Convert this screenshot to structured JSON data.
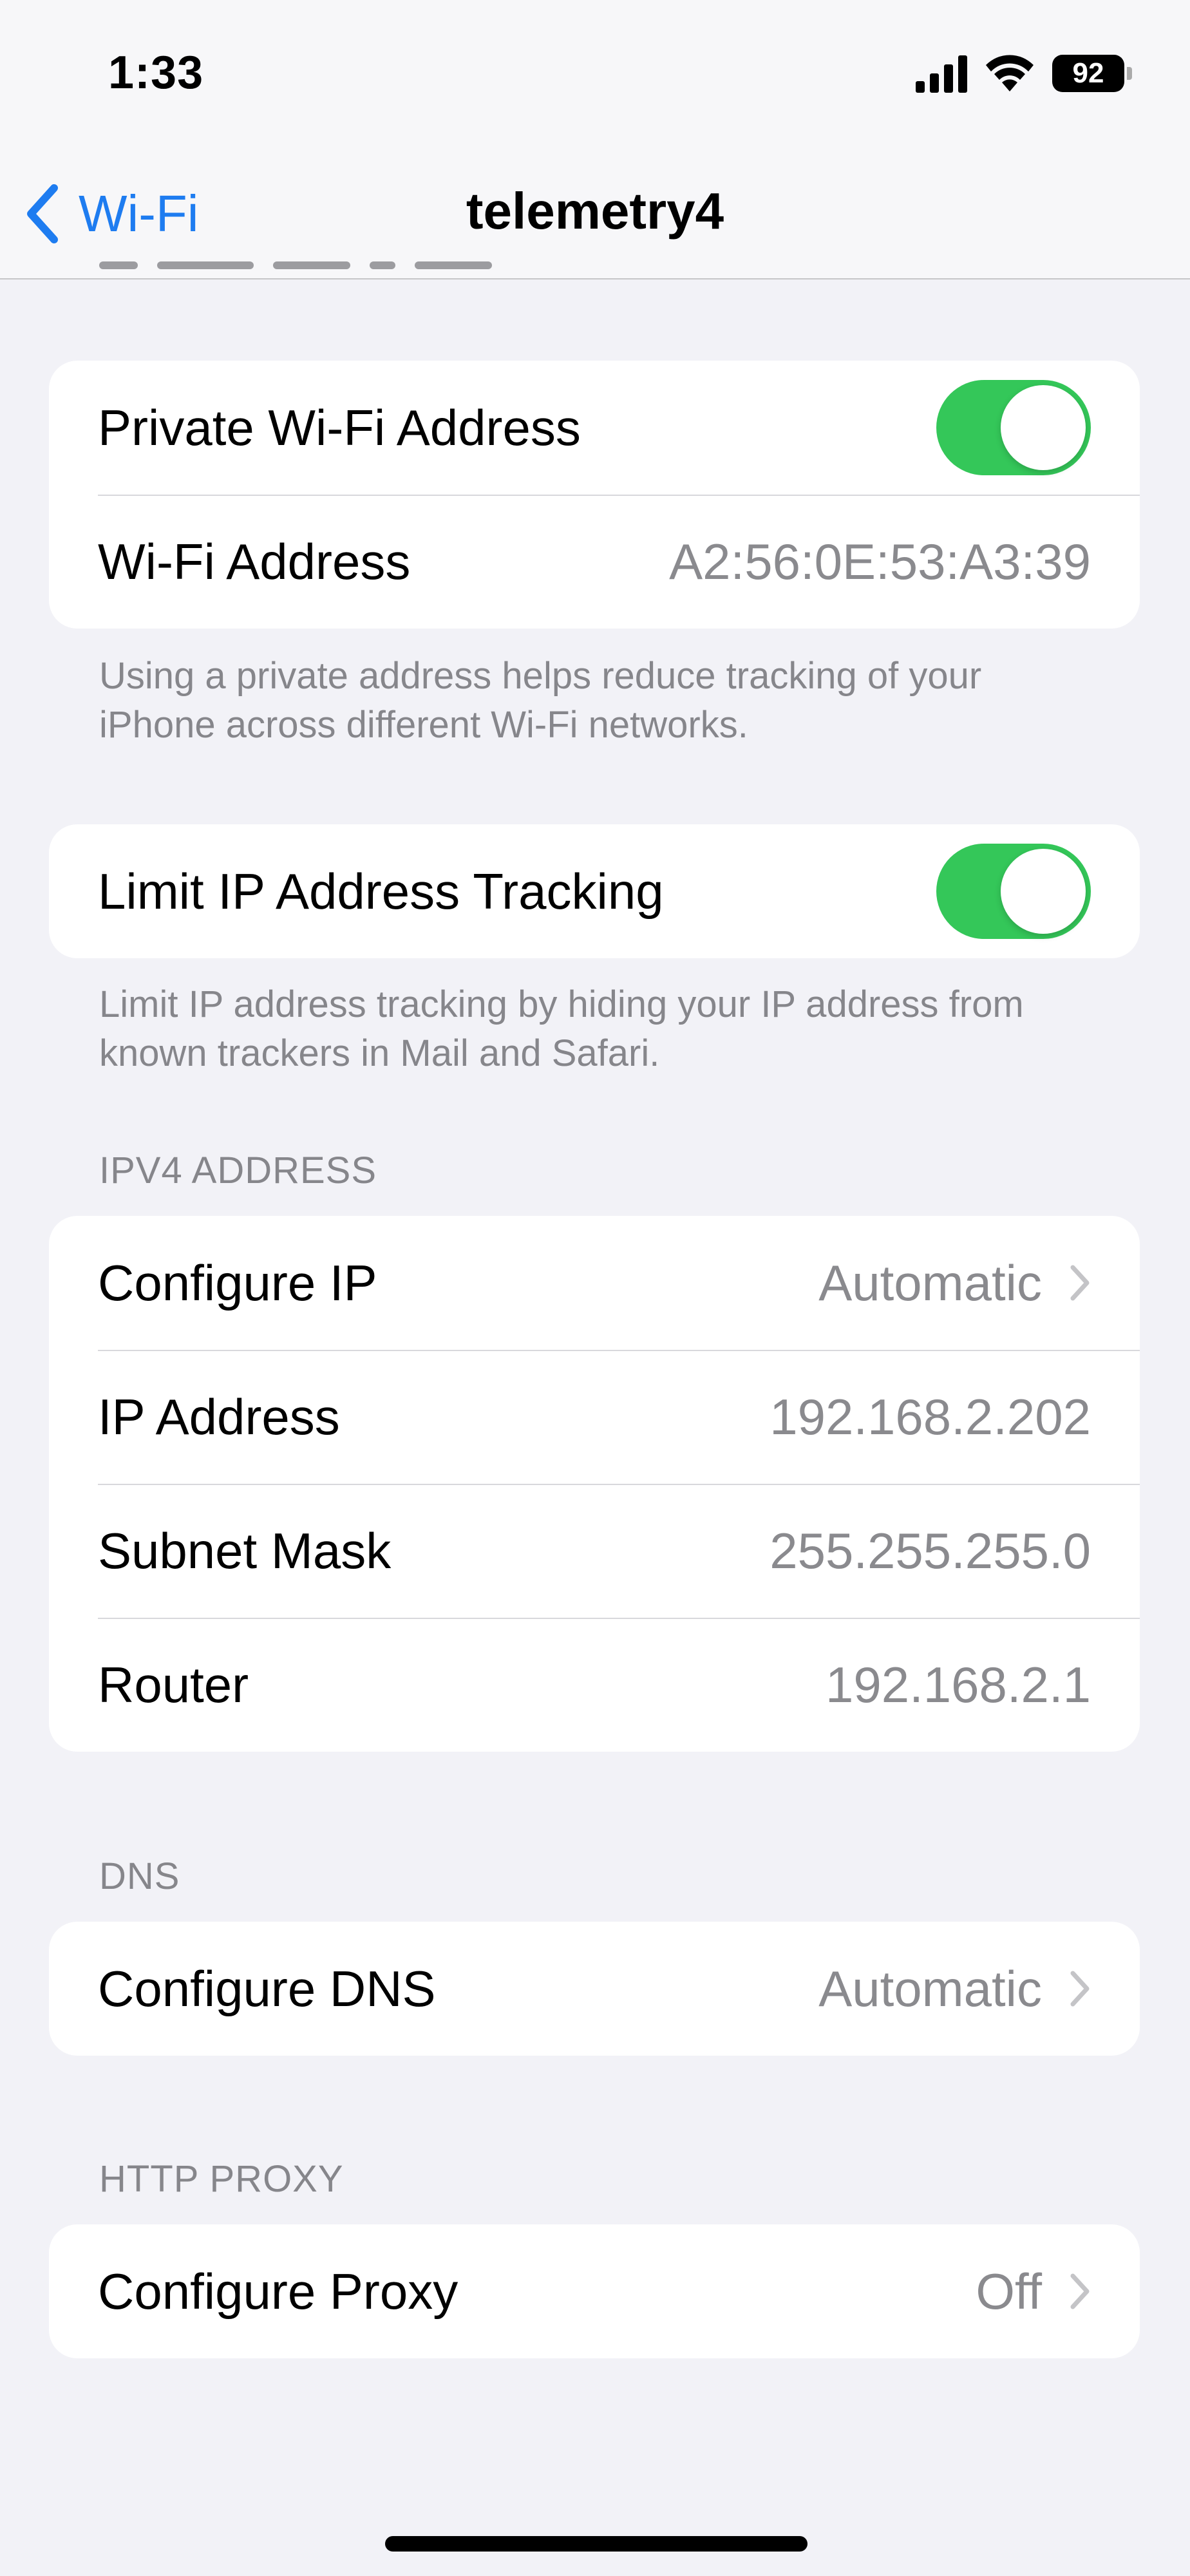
{
  "status_bar": {
    "time": "1:33",
    "battery_level": "92",
    "icons": [
      "signal-icon",
      "wifi-icon",
      "battery-icon"
    ]
  },
  "nav": {
    "back_label": "Wi-Fi",
    "title": "telemetry4"
  },
  "private_address": {
    "toggle_label": "Private Wi-Fi Address",
    "toggle_on": true,
    "address_label": "Wi-Fi Address",
    "address_value": "A2:56:0E:53:A3:39",
    "footer": "Using a private address helps reduce tracking of your iPhone across different Wi-Fi networks."
  },
  "limit_tracking": {
    "toggle_label": "Limit IP Address Tracking",
    "toggle_on": true,
    "footer": "Limit IP address tracking by hiding your IP address from known trackers in Mail and Safari."
  },
  "ipv4": {
    "header": "IPV4 ADDRESS",
    "configure_label": "Configure IP",
    "configure_value": "Automatic",
    "ip_label": "IP Address",
    "ip_value": "192.168.2.202",
    "subnet_label": "Subnet Mask",
    "subnet_value": "255.255.255.0",
    "router_label": "Router",
    "router_value": "192.168.2.1"
  },
  "dns": {
    "header": "DNS",
    "configure_label": "Configure DNS",
    "configure_value": "Automatic"
  },
  "proxy": {
    "header": "HTTP PROXY",
    "configure_label": "Configure Proxy",
    "configure_value": "Off"
  },
  "colors": {
    "accent": "#1e7cf0",
    "toggle_on": "#34c759",
    "background": "#f2f2f7",
    "secondary_text": "#8a8a8e"
  }
}
